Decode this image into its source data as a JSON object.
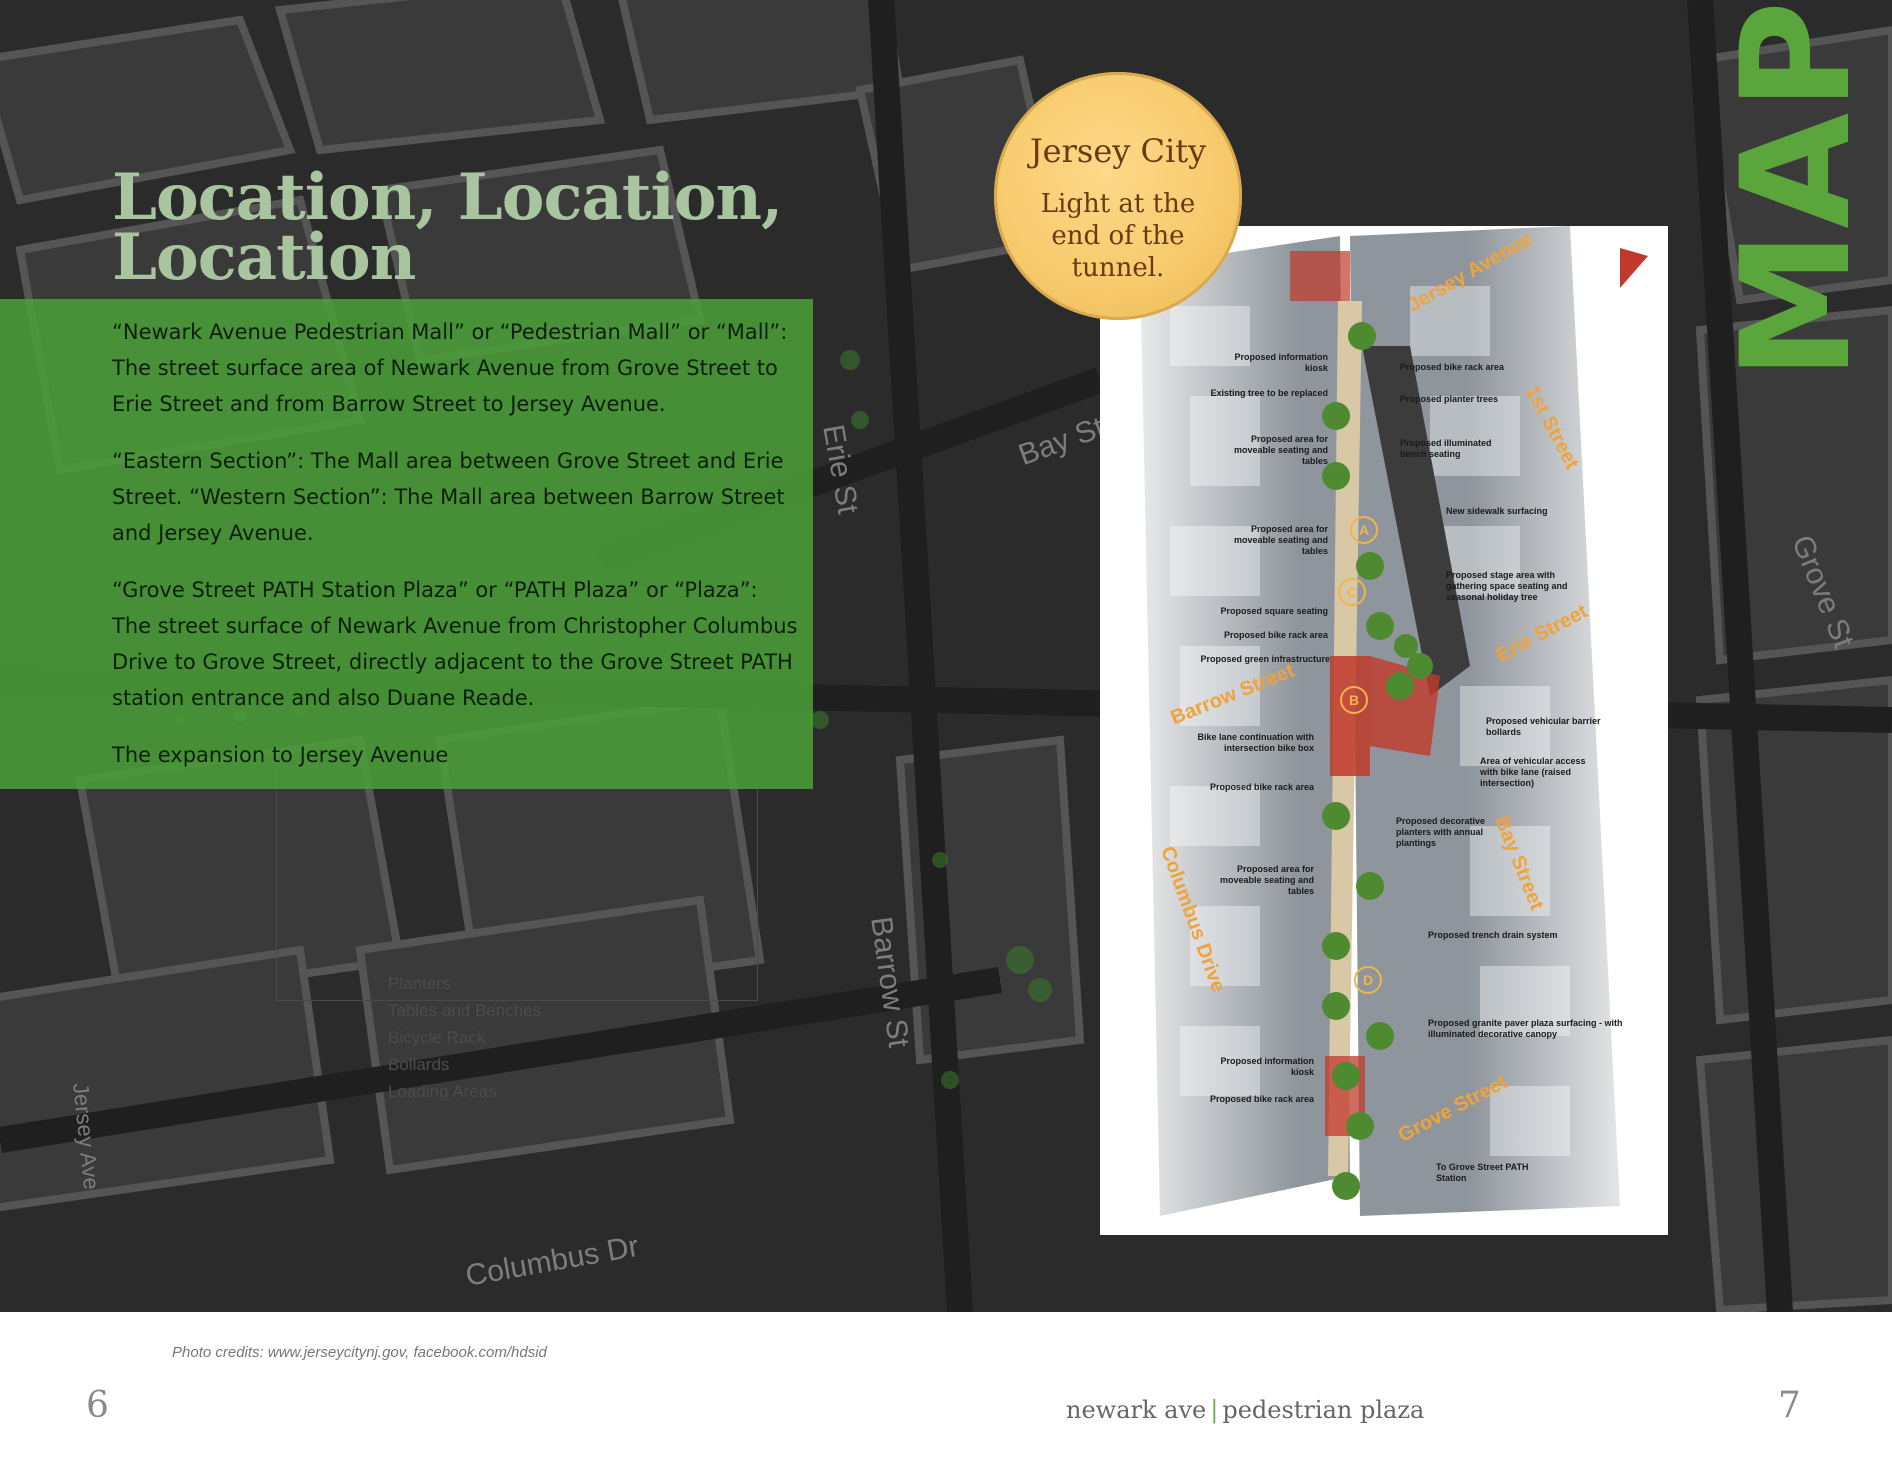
{
  "heading": "Location, Location, Location",
  "definitions": [
    "“Newark Avenue Pedestrian Mall” or “Pedestrian Mall” or “Mall”: The street surface area of Newark Avenue from Grove Street to Erie Street and from Barrow Street to Jersey Avenue.",
    "“Eastern Section”: The Mall area between Grove Street and Erie Street. “Western Section”: The Mall area between Barrow Street and Jersey Avenue.",
    "“Grove Street PATH Station Plaza” or “PATH Plaza” or “Plaza”: The street surface of Newark Avenue from Christopher Columbus Drive to Grove Street, directly adjacent to the Grove Street PATH station entrance and also Duane Reade.",
    "The expansion to Jersey Avenue"
  ],
  "background_map": {
    "street_labels": [
      "Erie St",
      "Bay St",
      "Barrow St",
      "Jersey Ave",
      "Columbus Dr",
      "Grove St"
    ],
    "legend": [
      "Planters",
      "Tables and Benches",
      "Bicycle Rack",
      "Bollards",
      "Loading Areas"
    ]
  },
  "badge": {
    "title": "Jersey City",
    "subtitle": "Light at the end of the tunnel."
  },
  "plan": {
    "streets": [
      "Jersey Avenue",
      "1st Street",
      "Erie Street",
      "Barrow Street",
      "Bay Street",
      "Columbus Drive",
      "Grove Street"
    ],
    "markers": [
      "A",
      "C",
      "B",
      "D"
    ],
    "notes_left": [
      "Proposed information kiosk",
      "Existing tree to be replaced",
      "Proposed area for moveable seating and tables",
      "Proposed area for moveable seating and tables",
      "Proposed square seating",
      "Proposed bike rack area",
      "Proposed green infrastructure",
      "Bike lane continuation with intersection bike box",
      "Proposed bike rack area",
      "Proposed area for moveable seating and tables",
      "Proposed information kiosk",
      "Proposed bike rack area"
    ],
    "notes_right": [
      "Proposed bike rack area",
      "Proposed planter trees",
      "Proposed illuminated bench seating",
      "New sidewalk surfacing",
      "Proposed stage area with gathering space seating and seasonal holiday tree",
      "Proposed vehicular barrier bollards",
      "Area of vehicular access with bike lane (raised intersection)",
      "Proposed decorative planters with annual plantings",
      "Proposed trench drain system",
      "Proposed granite paver plaza surfacing - with illuminated decorative canopy",
      "To Grove Street PATH Station"
    ]
  },
  "side_word": "MAP",
  "footer": {
    "credits": "Photo credits: www.jerseycitynj.gov, facebook.com/hdsid",
    "left_page": "6",
    "right_page": "7",
    "title_left": "newark ave",
    "separator": "|",
    "title_right": "pedestrian plaza"
  },
  "colors": {
    "accent_green": "#5aa53c",
    "panel_green": "#4ca038",
    "heading_green": "#a9c5a0",
    "map_dark": "#2b2b2b",
    "badge_gold": "#f6c96a",
    "street_orange": "#f0a33a"
  }
}
